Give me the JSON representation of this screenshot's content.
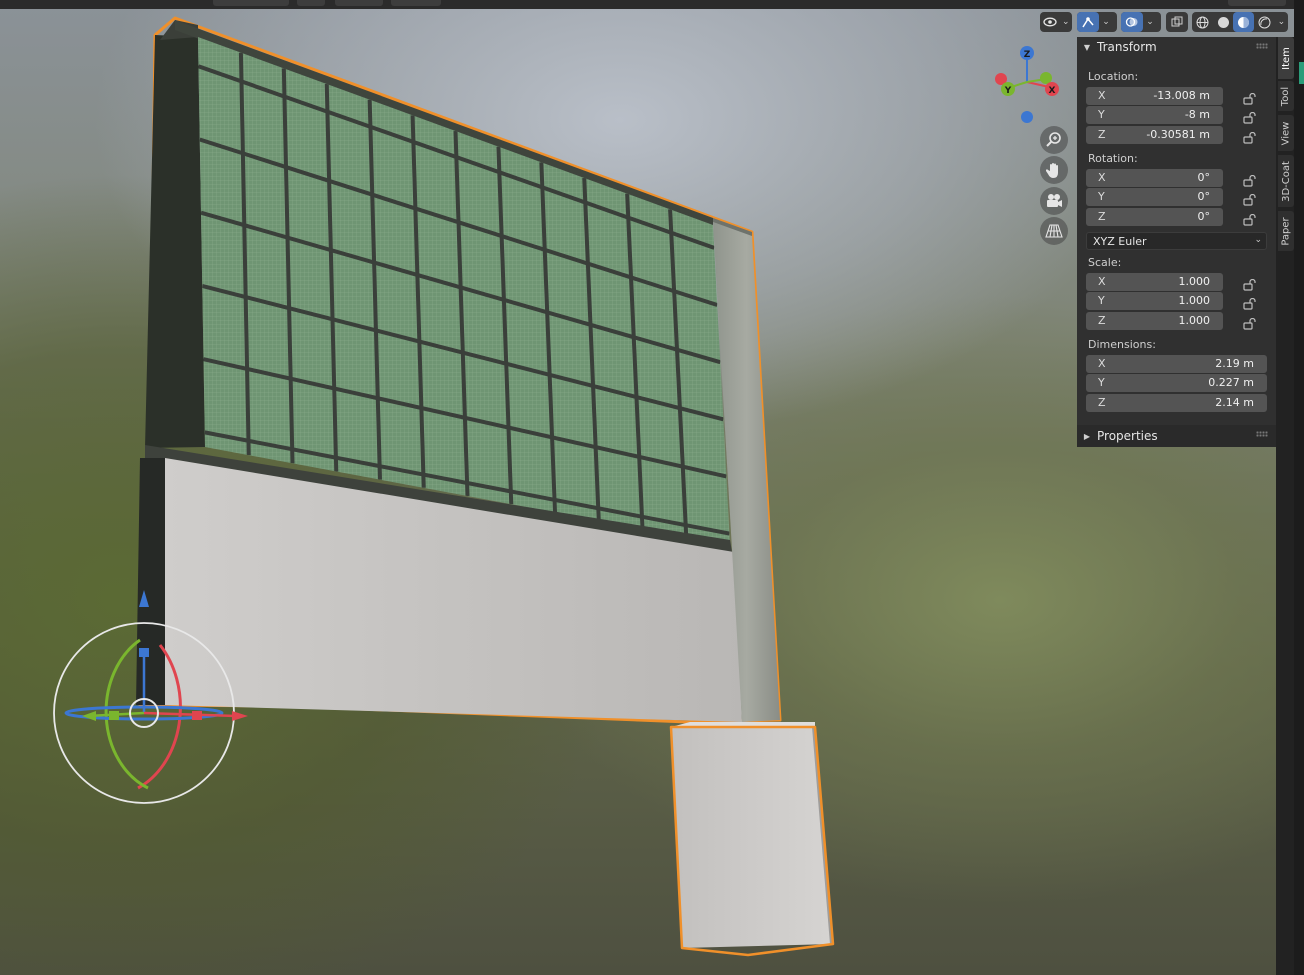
{
  "header": {
    "shading_modes": [
      "wireframe-shading",
      "solid-shading",
      "material-preview-shading",
      "rendered-shading"
    ],
    "active_shading": "material-preview-shading"
  },
  "gizmo": {
    "x_label": "X",
    "y_label": "Y",
    "z_label": "Z"
  },
  "transform_panel": {
    "title": "Transform",
    "location": {
      "label": "Location:",
      "fields": [
        {
          "axis": "X",
          "value": "-13.008 m"
        },
        {
          "axis": "Y",
          "value": "-8 m"
        },
        {
          "axis": "Z",
          "value": "-0.30581 m"
        }
      ]
    },
    "rotation": {
      "label": "Rotation:",
      "fields": [
        {
          "axis": "X",
          "value": "0°"
        },
        {
          "axis": "Y",
          "value": "0°"
        },
        {
          "axis": "Z",
          "value": "0°"
        }
      ],
      "mode": "XYZ Euler"
    },
    "scale": {
      "label": "Scale:",
      "fields": [
        {
          "axis": "X",
          "value": "1.000"
        },
        {
          "axis": "Y",
          "value": "1.000"
        },
        {
          "axis": "Z",
          "value": "1.000"
        }
      ]
    },
    "dimensions": {
      "label": "Dimensions:",
      "fields": [
        {
          "axis": "X",
          "value": "2.19 m"
        },
        {
          "axis": "Y",
          "value": "0.227 m"
        },
        {
          "axis": "Z",
          "value": "2.14 m"
        }
      ]
    }
  },
  "properties_panel": {
    "title": "Properties"
  },
  "sidebar_tabs": [
    "Item",
    "Tool",
    "View",
    "3D-Coat",
    "Paper"
  ],
  "active_tab": "Item",
  "colors": {
    "selection_outline": "#f0902a",
    "active_button": "#4772b3",
    "panel_bg": "#303030",
    "field_bg": "#545454",
    "axis_x": "#e0454f",
    "axis_y": "#7ab62e",
    "axis_z": "#3c77d2"
  }
}
